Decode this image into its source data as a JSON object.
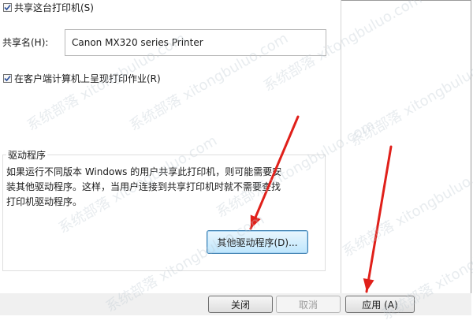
{
  "share_checkbox": {
    "label": "共享这台打印机(S)",
    "checked": true
  },
  "share_name": {
    "label": "共享名(H):",
    "value": "Canon MX320 series Printer"
  },
  "render_checkbox": {
    "label": "在客户端计算机上呈现打印作业(R)",
    "checked": true
  },
  "drivers_group": {
    "title": "驱动程序",
    "description_lines": [
      "如果运行不同版本 Windows 的用户共享此打印机，则可能需要安",
      "装其他驱动程序。这样，当用户连接到共享打印机时就不需要查找",
      "打印机驱动程序。"
    ],
    "additional_drivers_button": "其他驱动程序(D)..."
  },
  "footer": {
    "close_button": "关闭",
    "cancel_button": "取消",
    "apply_button": "应用 (A)"
  },
  "annotation": {
    "arrow_color": "#e0201a"
  },
  "watermark_text": "系统部落 xitongbuluo.com"
}
